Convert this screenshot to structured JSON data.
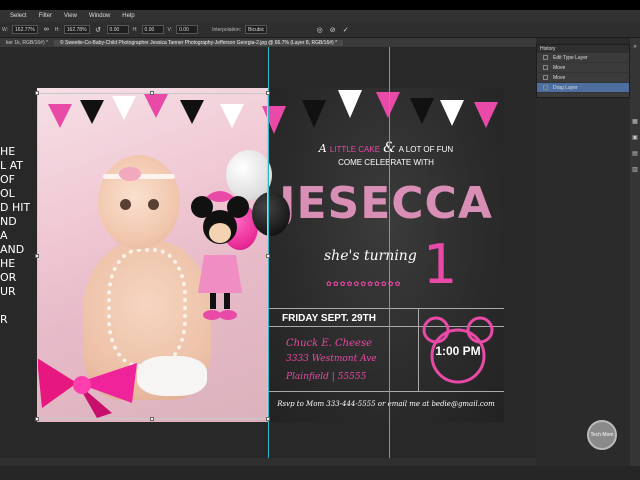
{
  "menu": {
    "items": [
      "Select",
      "Filter",
      "View",
      "Window",
      "Help"
    ]
  },
  "options": {
    "w_label": "W:",
    "w_value": "162.77%",
    "h_label": "H:",
    "h_value": "162.78%",
    "angle_value": "0.00",
    "h_skew_label": "H:",
    "h_skew_value": "0.00",
    "v_skew_label": "V:",
    "v_skew_value": "0.00",
    "interp_label": "Interpolation:",
    "interp_value": "Bicubic"
  },
  "document_tab": {
    "left_label": "ker 1k, RGB/16#) *",
    "label": "© Sweetie-Co-Baby-Child Photographer Jessica Tanner Photography-Jefferson Georgia-2.jpg @ 66.7% (Layer 8, RGB/16#) *"
  },
  "left_overlay_text": [
    "HE",
    "L AT",
    "OF",
    "OL",
    "D HIT",
    "ND",
    "A",
    "AND",
    "HE",
    "OR",
    "UR",
    "",
    "R"
  ],
  "invite": {
    "tagline_a": "A",
    "tagline_mid": "LITTLE CAKE",
    "tagline_amp": "&",
    "tagline_end": "A LOT OF FUN",
    "come": "COME CELEBRATE WITH",
    "name": "JESECCA",
    "turning": "she's turning",
    "age": "1",
    "date": "FRIDAY SEPT. 29TH",
    "venue": "Chuck E. Cheese",
    "address": "3333 Westmont Ave",
    "city": "Plainfield | 55555",
    "time": "1:00 PM",
    "rsvp": "Rsvp to Mom 333-444-5555 or email me at bedie@gmail.com"
  },
  "history": {
    "title": "History",
    "rows": [
      {
        "label": "Edit Type Layer",
        "active": false
      },
      {
        "label": "Edit Type Layer",
        "active": false
      },
      {
        "label": "Move",
        "active": false
      },
      {
        "label": "Move",
        "active": false
      },
      {
        "label": "Drag Layer",
        "active": true
      }
    ]
  },
  "watermark": {
    "text": "Tech Mom"
  },
  "colors": {
    "guide": "#2fb8c8",
    "pink": "#ea4aa7",
    "menu_bg": "#323232",
    "history_active": "#4d6fa0"
  }
}
